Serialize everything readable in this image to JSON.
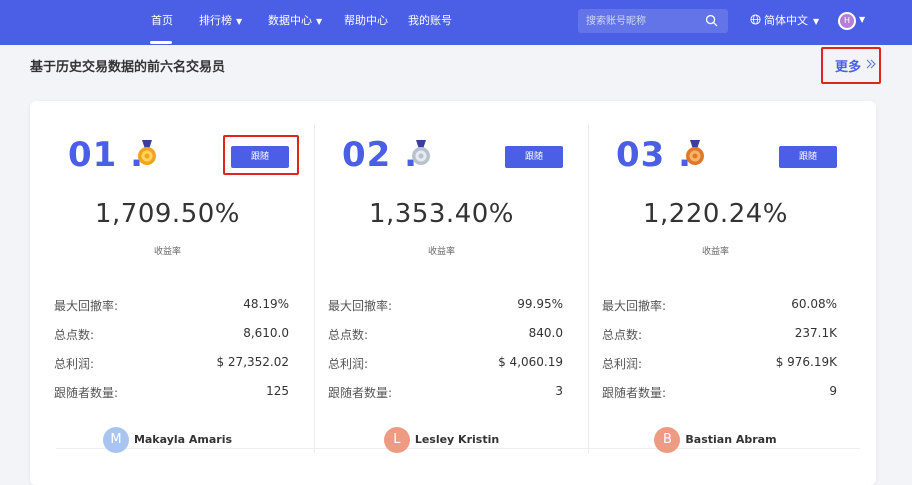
{
  "colors": {
    "brand": "#4a5ee6",
    "highlight": "#e0261c",
    "avatar_1": "#a9c4ef",
    "avatar_2": "#ee9b83",
    "avatar_3": "#ee9b83"
  },
  "nav": {
    "items": [
      {
        "label": "首页",
        "has_caret": false,
        "active": true
      },
      {
        "label": "排行榜",
        "has_caret": true,
        "active": false
      },
      {
        "label": "数据中心",
        "has_caret": true,
        "active": false
      },
      {
        "label": "帮助中心",
        "has_caret": false,
        "active": false
      },
      {
        "label": "我的账号",
        "has_caret": false,
        "active": false
      }
    ],
    "search_placeholder": "搜索账号昵称",
    "language": "简体中文",
    "avatar_letter": "H",
    "icons": {
      "search": "search-icon",
      "globe": "globe-icon"
    }
  },
  "section": {
    "title": "基于历史交易数据的前六名交易员",
    "more": "更多"
  },
  "traders": [
    {
      "rank": "01 .",
      "medal": "gold-medal-icon",
      "follow": "跟随",
      "yield": "1,709.50%",
      "yield_label": "收益率",
      "stats": [
        {
          "label": "最大回撤率:",
          "value": "48.19%"
        },
        {
          "label": "总点数:",
          "value": "8,610.0"
        },
        {
          "label": "总利润:",
          "value": "$ 27,352.02"
        },
        {
          "label": "跟随者数量:",
          "value": "125"
        }
      ],
      "initial": "M",
      "name": "Makayla Amaris"
    },
    {
      "rank": "02 .",
      "medal": "silver-medal-icon",
      "follow": "跟随",
      "yield": "1,353.40%",
      "yield_label": "收益率",
      "stats": [
        {
          "label": "最大回撤率:",
          "value": "99.95%"
        },
        {
          "label": "总点数:",
          "value": "840.0"
        },
        {
          "label": "总利润:",
          "value": "$ 4,060.19"
        },
        {
          "label": "跟随者数量:",
          "value": "3"
        }
      ],
      "initial": "L",
      "name": "Lesley Kristin"
    },
    {
      "rank": "03 .",
      "medal": "bronze-medal-icon",
      "follow": "跟随",
      "yield": "1,220.24%",
      "yield_label": "收益率",
      "stats": [
        {
          "label": "最大回撤率:",
          "value": "60.08%"
        },
        {
          "label": "总点数:",
          "value": "237.1K"
        },
        {
          "label": "总利润:",
          "value": "$ 976.19K"
        },
        {
          "label": "跟随者数量:",
          "value": "9"
        }
      ],
      "initial": "B",
      "name": "Bastian Abram"
    }
  ]
}
